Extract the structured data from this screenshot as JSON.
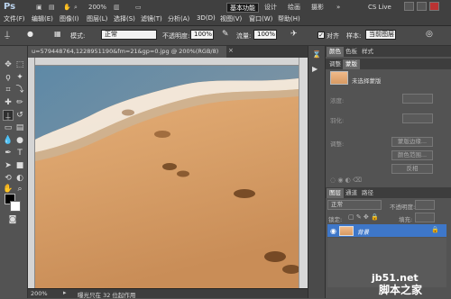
{
  "app": {
    "logo": "Ps"
  },
  "menu": [
    "文件(F)",
    "编辑(E)",
    "图像(I)",
    "图层(L)",
    "选择(S)",
    "滤镜(T)",
    "分析(A)",
    "3D(D)",
    "视图(V)",
    "窗口(W)",
    "帮助(H)"
  ],
  "topbar": {
    "zoom": "200%",
    "workspaces": [
      "基本功能",
      "设计",
      "绘画",
      "摄影"
    ],
    "active_workspace": "基本功能",
    "more": "»",
    "cs_live": "CS Live"
  },
  "options": {
    "mode_label": "模式:",
    "mode_value": "正常",
    "opacity_label": "不透明度:",
    "opacity_value": "100%",
    "flow_label": "流量:",
    "flow_value": "100%",
    "align_label": "对齐",
    "sample_label": "样本:",
    "sample_value": "当前图层"
  },
  "document": {
    "tab_title": "u=579448764,1228951190&fm=21&gp=0.jpg @ 200%(RGB/8)"
  },
  "status": {
    "zoom": "200%",
    "message": "曝光只在 32 位起作用"
  },
  "panels": {
    "top_tabs": [
      "颜色",
      "色板",
      "样式"
    ],
    "mid_tabs": [
      "调整",
      "蒙版"
    ],
    "mask_title": "未选择蒙版",
    "mask_density": "浓度:",
    "mask_feather": "羽化:",
    "mask_refine": "调整:",
    "mask_btn_edge": "蒙版边缘...",
    "mask_btn_color": "颜色范围...",
    "mask_btn_invert": "反相"
  },
  "layers": {
    "tabs": [
      "图层",
      "通道",
      "路径"
    ],
    "blend_mode": "正常",
    "opacity_label": "不透明度:",
    "lock_label": "锁定:",
    "fill_label": "填充:",
    "layer_name": "背景"
  },
  "watermark": {
    "site": "jb51.net",
    "brand": "脚本之家"
  },
  "colors": {
    "selection": "#3e77c9",
    "background": "#535353"
  }
}
